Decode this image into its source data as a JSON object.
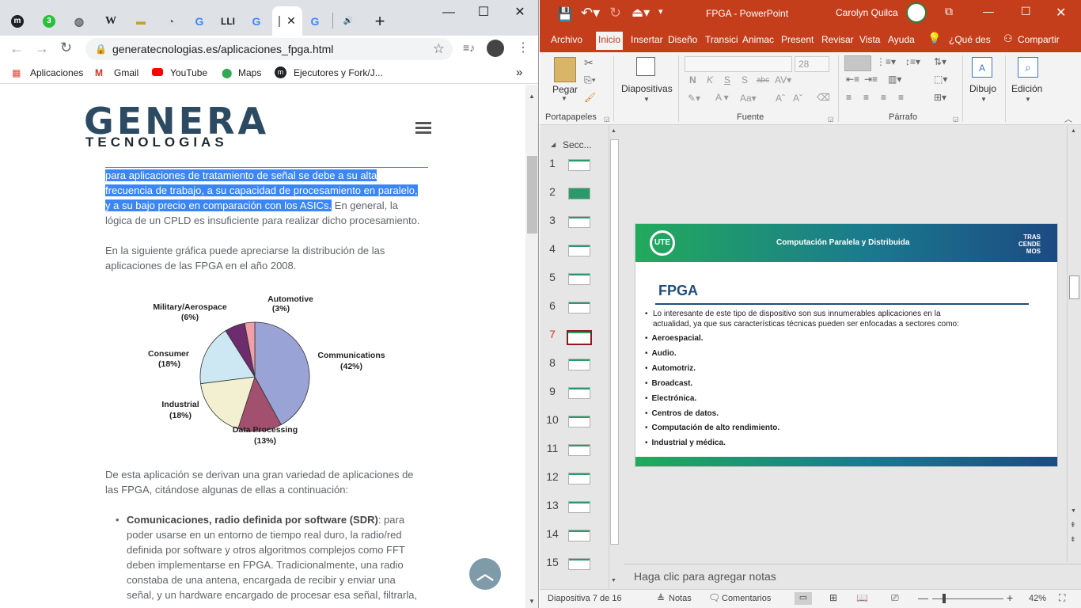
{
  "browser": {
    "tabs": [
      {
        "name": "tab-m",
        "icon": "m-logo-icon",
        "glyph": "m"
      },
      {
        "name": "tab-whatsapp",
        "icon": "whatsapp-icon",
        "glyph": "3"
      },
      {
        "name": "tab-globe",
        "icon": "globe-icon",
        "glyph": "◍"
      },
      {
        "name": "tab-wikipedia",
        "icon": "wikipedia-icon",
        "glyph": "W"
      },
      {
        "name": "tab-chart",
        "icon": "chart-icon",
        "glyph": "▬"
      },
      {
        "name": "tab-dash",
        "icon": "dashboard-icon",
        "glyph": "◔"
      },
      {
        "name": "tab-google-1",
        "icon": "google-icon",
        "glyph": "G"
      },
      {
        "name": "tab-books",
        "icon": "books-icon",
        "glyph": "LLI"
      },
      {
        "name": "tab-google-2",
        "icon": "google-icon",
        "glyph": "G"
      },
      {
        "name": "tab-active",
        "icon": "page-icon",
        "glyph": ""
      },
      {
        "name": "tab-google-3",
        "icon": "google-icon",
        "glyph": "G"
      },
      {
        "name": "tab-audio",
        "icon": "speaker-icon",
        "glyph": "🔊"
      }
    ],
    "active_close": "✕",
    "new_tab": "+",
    "window_controls": {
      "minimize": "—",
      "maximize": "☐",
      "close": "✕"
    },
    "url": "generatecnologias.es/aplicaciones_fpga.html",
    "bookmarks": [
      {
        "label": "Aplicaciones",
        "icon": "apps-grid-icon"
      },
      {
        "label": "Gmail",
        "icon": "gmail-icon"
      },
      {
        "label": "YouTube",
        "icon": "youtube-icon"
      },
      {
        "label": "Maps",
        "icon": "maps-pin-icon"
      },
      {
        "label": "Ejecutores y Fork/J...",
        "icon": "m-logo-icon"
      }
    ],
    "bookmarks_more": "»"
  },
  "website": {
    "logo_top": "GENERA",
    "logo_bottom": "TECNOLOGIAS",
    "para1_highlight_1": "para aplicaciones de tratamiento de señal se debe a su alta",
    "para1_highlight_2": "frecuencia de trabajo, a su capacidad de procesamiento en paralelo,",
    "para1_highlight_3": "y a su bajo precio en comparación con los ASICs.",
    "para1_rest_a": " En general, la",
    "para1_rest_b": "lógica de un CPLD es insuficiente para realizar dicho procesamiento.",
    "para2_a": "En la siguiente gráfica puede apreciarse la distribución de las",
    "para2_b": "aplicaciones de las FPGA en el año 2008.",
    "para3_a": "De esta aplicación se derivan una gran variedad  de aplicaciones de",
    "para3_b": "las FPGA, citándose algunas de ellas a continuación:",
    "bullet_title": "Comunicaciones, radio definida por software (SDR)",
    "bullet_l1": ": para",
    "bullet_l2": "poder usarse en un entorno de tiempo real duro, la radio/red",
    "bullet_l3": "definida por software y otros algoritmos complejos como FFT",
    "bullet_l4": "deben implementarse en FPGA. Tradicionalmente, una radio",
    "bullet_l5": "constaba de una antena, encargada de recibir y enviar una",
    "bullet_l6": "señal, y un hardware encargado de procesar esa señal, filtrarla,"
  },
  "chart_data": {
    "type": "pie",
    "title": "",
    "slices": [
      {
        "label": "Communications",
        "value": 42,
        "color": "#9aa3d6"
      },
      {
        "label": "Data Processing",
        "value": 13,
        "color": "#a3506e"
      },
      {
        "label": "Industrial",
        "value": 18,
        "color": "#f3f0d2"
      },
      {
        "label": "Consumer",
        "value": 18,
        "color": "#cde8f2"
      },
      {
        "label": "Military/Aerospace",
        "value": 6,
        "color": "#6c2c6e"
      },
      {
        "label": "Automotive",
        "value": 3,
        "color": "#f2a0a8"
      }
    ],
    "value_labels": [
      "(42%)",
      "(13%)",
      "(18%)",
      "(18%)",
      "(6%)",
      "(3%)"
    ]
  },
  "powerpoint": {
    "title_bar": "FPGA  -  PowerPoint",
    "user": "Carolyn Quilca",
    "window_controls": {
      "restore": "⧉",
      "minimize": "—",
      "maximize": "☐",
      "close": "✕"
    },
    "ribbon_tabs": [
      "Archivo",
      "Inicio",
      "Insertar",
      "Diseño",
      "Transici",
      "Animac",
      "Present",
      "Revisar",
      "Vista",
      "Ayuda"
    ],
    "tell_me": "¿Qué des",
    "share": "Compartir",
    "groups": {
      "clipboard": "Portapapeles",
      "paste": "Pegar",
      "slides": "Diapositivas",
      "font": "Fuente",
      "font_size": "28",
      "paragraph": "Párrafo",
      "drawing": "Dibujo",
      "editing": "Edición"
    },
    "section_label": "Secc...",
    "slide_numbers": [
      "1",
      "2",
      "3",
      "4",
      "5",
      "6",
      "7",
      "8",
      "9",
      "10",
      "11",
      "12",
      "13",
      "14",
      "15"
    ],
    "current_slide": "7",
    "slide": {
      "header": "Computación Paralela y Distribuida",
      "logo_left": "UTE",
      "logo_right_1": "TRAS",
      "logo_right_2": "CENDE",
      "logo_right_3": "MOS",
      "title": "FPGA",
      "intro_1": "Lo interesante de este tipo de dispositivo son sus innumerables aplicaciones en la",
      "intro_2": "actualidad, ya que sus características técnicas pueden ser enfocadas a sectores como:",
      "items": [
        "Aeroespacial.",
        "Audio.",
        "Automotriz.",
        "Broadcast.",
        "Electrónica.",
        "Centros de datos.",
        "Computación de alto rendimiento.",
        "Industrial y médica."
      ]
    },
    "notes_placeholder": "Haga clic para agregar notas",
    "status": {
      "slide_counter": "Diapositiva 7 de 16",
      "notes": "Notas",
      "comments": "Comentarios",
      "zoom": "42%"
    }
  }
}
